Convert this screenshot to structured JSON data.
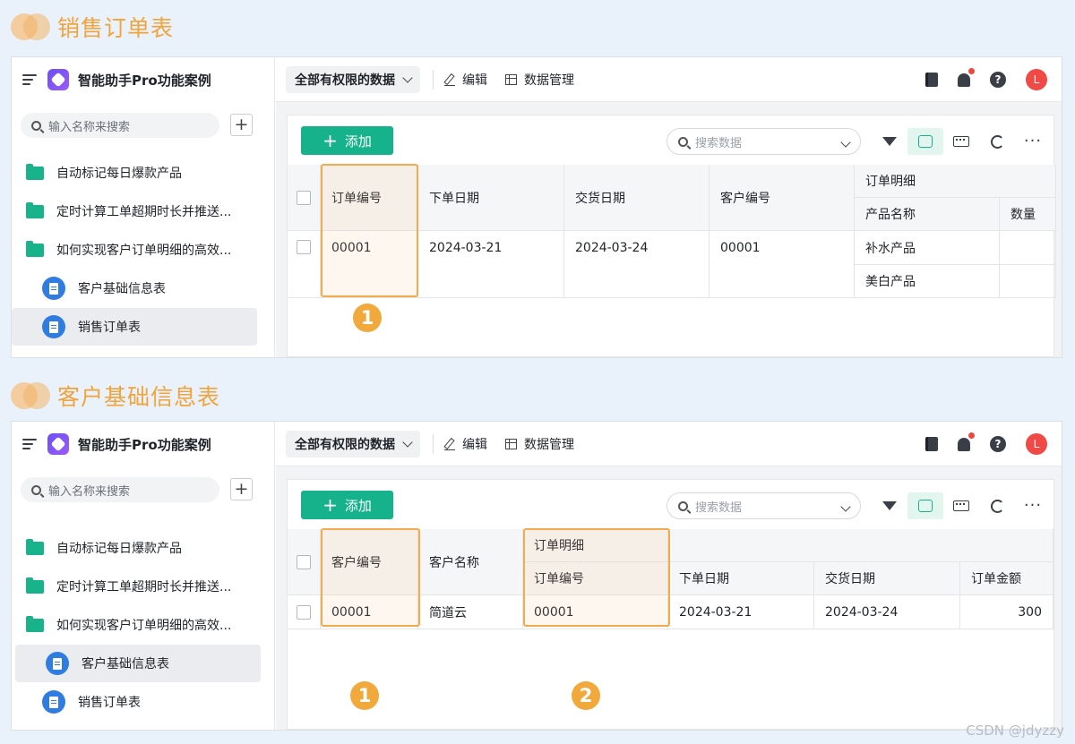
{
  "watermark": "CSDN @jdyzzy",
  "panels": [
    {
      "section_title": "销售订单表",
      "app_name": "智能助手Pro功能案例",
      "sidebar_search_placeholder": "输入名称来搜索",
      "nav": [
        "自动标记每日爆款产品",
        "定时计算工单超期时长并推送...",
        "如何实现客户订单明细的高效...",
        "客户基础信息表",
        "销售订单表"
      ],
      "selected_nav": "销售订单表",
      "toolbar": {
        "dropdown": "全部有权限的数据",
        "edit": "编辑",
        "data_manage": "数据管理",
        "avatar": "L"
      },
      "add_label": "添加",
      "search_placeholder": "搜索数据",
      "table": {
        "headers": [
          "订单编号",
          "下单日期",
          "交货日期",
          "客户编号"
        ],
        "group_header": "订单明细",
        "sub_headers": [
          "产品名称",
          "数量"
        ],
        "row": {
          "values": [
            "00001",
            "2024-03-21",
            "2024-03-24",
            "00001"
          ],
          "products": [
            "补水产品",
            "美白产品"
          ]
        }
      },
      "badges": [
        "1"
      ]
    },
    {
      "section_title": "客户基础信息表",
      "app_name": "智能助手Pro功能案例",
      "sidebar_search_placeholder": "输入名称来搜索",
      "nav": [
        "自动标记每日爆款产品",
        "定时计算工单超期时长并推送...",
        "如何实现客户订单明细的高效...",
        "客户基础信息表",
        "销售订单表"
      ],
      "selected_nav": "客户基础信息表",
      "toolbar": {
        "dropdown": "全部有权限的数据",
        "edit": "编辑",
        "data_manage": "数据管理",
        "avatar": "L"
      },
      "add_label": "添加",
      "search_placeholder": "搜索数据",
      "table": {
        "headers": [
          "客户编号",
          "客户名称"
        ],
        "group_header": "订单明细",
        "sub_headers": [
          "订单编号",
          "下单日期",
          "交货日期",
          "订单金额"
        ],
        "row": {
          "values": [
            "00001",
            "简道云",
            "00001",
            "2024-03-21",
            "2024-03-24",
            "300"
          ]
        }
      },
      "badges": [
        "1",
        "2"
      ]
    }
  ]
}
